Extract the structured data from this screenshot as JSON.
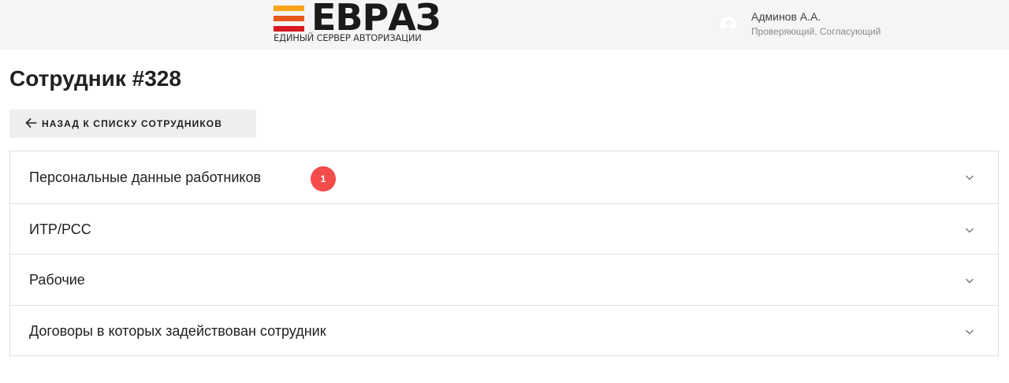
{
  "header": {
    "logo": {
      "wordmark": "ЕВРАЗ",
      "subtitle": "ЕДИНЫЙ СЕРВЕР АВТОРИЗАЦИИ",
      "stripe_colors": [
        "#f7a51d",
        "#e8581c",
        "#d71920"
      ]
    },
    "user": {
      "icon": "account-circle-icon",
      "name": "Админов А.А.",
      "roles": "Проверяющий, Согласующий"
    }
  },
  "page": {
    "title": "Сотрудник #328",
    "back_button": {
      "icon": "arrow-left-icon",
      "label": "НАЗАД К СПИСКУ СОТРУДНИКОВ"
    }
  },
  "accordion": {
    "panels": [
      {
        "label": "Персональные данные работников",
        "badge": "1",
        "icon": "chevron-down-icon"
      },
      {
        "label": "ИТР/РСС",
        "icon": "chevron-down-icon"
      },
      {
        "label": "Рабочие",
        "icon": "chevron-down-icon"
      },
      {
        "label": "Договоры в которых задействован сотрудник",
        "icon": "chevron-down-icon"
      }
    ]
  },
  "colors": {
    "header_bg": "#f5f5f5",
    "badge": "#f44b4b",
    "button_bg": "#eeeeee",
    "border": "#e0e0e0"
  }
}
